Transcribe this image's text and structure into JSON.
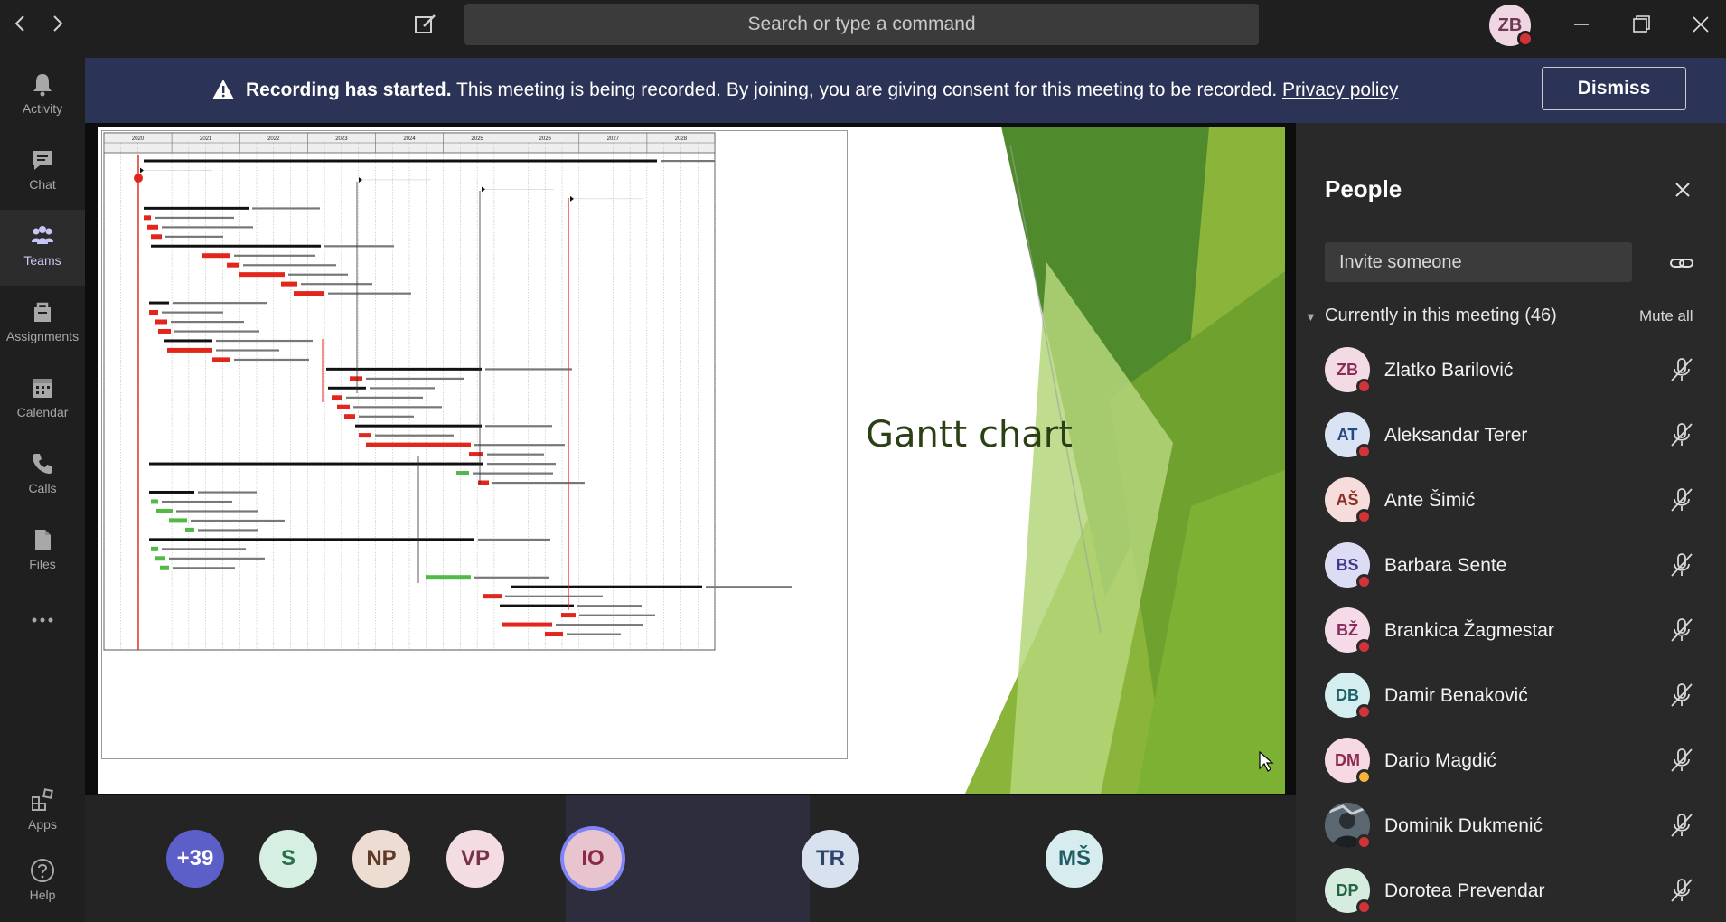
{
  "titlebar": {
    "search_placeholder": "Search or type a command",
    "me_initials": "ZB"
  },
  "rail": {
    "items": [
      {
        "label": "Activity",
        "icon": "bell-icon"
      },
      {
        "label": "Chat",
        "icon": "chat-icon"
      },
      {
        "label": "Teams",
        "icon": "teams-icon",
        "active": true
      },
      {
        "label": "Assignments",
        "icon": "assignments-icon"
      },
      {
        "label": "Calendar",
        "icon": "calendar-icon"
      },
      {
        "label": "Calls",
        "icon": "phone-icon"
      },
      {
        "label": "Files",
        "icon": "files-icon"
      },
      {
        "label": "Apps",
        "icon": "apps-icon"
      },
      {
        "label": "Help",
        "icon": "help-icon"
      }
    ]
  },
  "banner": {
    "bold": "Recording has started.",
    "text": " This meeting is being recorded. By joining, you are giving consent for this meeting to be recorded. ",
    "link": "Privacy policy",
    "dismiss_label": "Dismiss"
  },
  "slide": {
    "title": "Gantt chart",
    "gantt_years": [
      "2020",
      "2021",
      "2022",
      "2023",
      "2024",
      "2025",
      "2026",
      "2027",
      "2028"
    ]
  },
  "strip": {
    "tiles": [
      {
        "initials": "+39",
        "bg": "#5b5fc7",
        "fg": "#ffffff"
      },
      {
        "initials": "S",
        "bg": "#d6efe3",
        "fg": "#2b6e4c"
      },
      {
        "initials": "NP",
        "bg": "#eddcd2",
        "fg": "#5e3a28"
      },
      {
        "initials": "VP",
        "bg": "#f3dde3",
        "fg": "#7a3246"
      },
      {
        "initials": "IO",
        "bg": "#e8c4cf",
        "fg": "#8a2a45"
      },
      {
        "initials": "TR",
        "bg": "#d8e1ee",
        "fg": "#2e456b"
      },
      {
        "initials": "MŠ",
        "bg": "#d7ecee",
        "fg": "#1f5c63"
      }
    ]
  },
  "people": {
    "title": "People",
    "invite_placeholder": "Invite someone",
    "meeting_header": "Currently in this meeting (46)",
    "mute_all": "Mute all",
    "list": [
      {
        "initials": "ZB",
        "name": "Zlatko Barilović",
        "bg": "#f3dbe6",
        "fg": "#8b2d57",
        "status": "#d13438"
      },
      {
        "initials": "AT",
        "name": "Aleksandar Terer",
        "bg": "#d9e3f4",
        "fg": "#234a82",
        "status": "#d13438"
      },
      {
        "initials": "AŠ",
        "name": "Ante Šimić",
        "bg": "#f6dcda",
        "fg": "#8e2d24",
        "status": "#d13438"
      },
      {
        "initials": "BS",
        "name": "Barbara Sente",
        "bg": "#dcdcf4",
        "fg": "#3d3a8e",
        "status": "#d13438"
      },
      {
        "initials": "BŽ",
        "name": "Brankica Žagmestar",
        "bg": "#f5dbe8",
        "fg": "#8a2d5e",
        "status": "#d13438"
      },
      {
        "initials": "DB",
        "name": "Damir Benaković",
        "bg": "#d4eef0",
        "fg": "#1f6066",
        "status": "#d13438"
      },
      {
        "initials": "DM",
        "name": "Dario Magdić",
        "bg": "#f7d9e4",
        "fg": "#8c2b52",
        "status": "#f8b13b"
      },
      {
        "initials": "",
        "name": "Dominik Dukmenić",
        "bg": "#55606a",
        "fg": "#ffffff",
        "status": "#d13438",
        "photo": true
      },
      {
        "initials": "DP",
        "name": "Dorotea Prevendar",
        "bg": "#d5ecdf",
        "fg": "#246447",
        "status": "#d13438"
      }
    ]
  }
}
